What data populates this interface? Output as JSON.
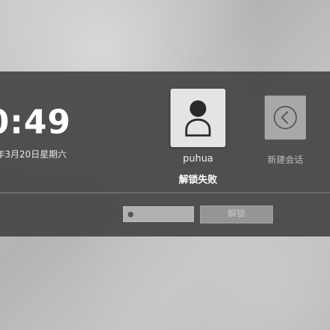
{
  "clock": {
    "time": "0:49"
  },
  "date": {
    "text": "年3月20日星期六"
  },
  "user": {
    "name": "puhua",
    "status": "解锁失败"
  },
  "new_session": {
    "label": "新建会话"
  },
  "login": {
    "password_dots": 1,
    "unlock_label": "解锁"
  },
  "colors": {
    "panel": "#464646",
    "avatar_bg": "#e4e4e4",
    "new_session_bg": "#a8a8a8",
    "unlock_bg": "#959595"
  }
}
